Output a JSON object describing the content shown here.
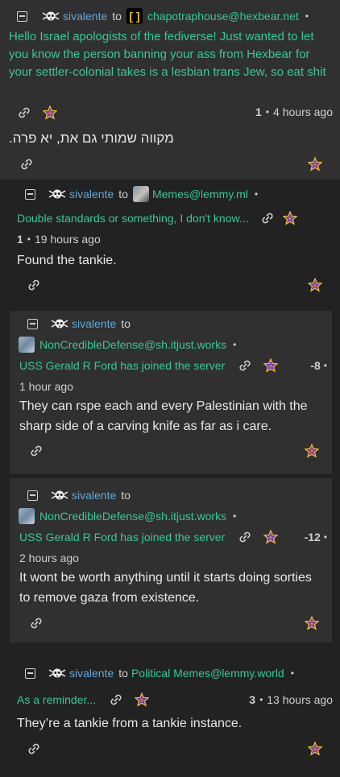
{
  "comments": [
    {
      "user": "sivalente",
      "to": "to",
      "community": "chapotraphouse@hexbear.net",
      "post_text": "Hello Israel apologists of the fediverse! Just wanted to let you know the person banning your ass from Hexbear for your settler-colonial takes is a lesbian trans Jew, so eat shit",
      "score": "1",
      "time": "4 hours ago",
      "body": "מקווה שמותי גם את, יא פרה."
    },
    {
      "user": "sivalente",
      "to": "to",
      "community": "Memes@lemmy.ml",
      "post_title": "Double standards or something, I don't know...",
      "score": "1",
      "time": "19 hours ago",
      "body": "Found the tankie."
    },
    {
      "user": "sivalente",
      "to": "to",
      "community": "NonCredibleDefense@sh.itjust.works",
      "post_title": "USS Gerald R Ford has joined the server",
      "score": "-8",
      "time": "1 hour ago",
      "body_lines": [
        "They can rspe each and every Palestinian with the",
        "sharp side of a carving knife as far as i care."
      ]
    },
    {
      "user": "sivalente",
      "to": "to",
      "community": "NonCredibleDefense@sh.itjust.works",
      "post_title": "USS Gerald R Ford has joined the server",
      "score": "-12",
      "time": "2 hours ago",
      "body_lines": [
        "It wont be worth anything until it starts doing sorties",
        "to remove gaza from existence."
      ]
    },
    {
      "user": "sivalente",
      "to": "to",
      "community": "Political Memes@lemmy.world",
      "post_title": "As a reminder...",
      "score": "3",
      "time": "13 hours ago",
      "body": "They’re a tankie from a tankie instance."
    }
  ],
  "separators": {
    "dot": "•"
  },
  "colors": {
    "user": "#5fa8d8",
    "community": "#34c89a",
    "card": "#303030",
    "background": "#222222"
  },
  "icons": {
    "collapse": "collapse-icon",
    "skull": "skull-icon",
    "link": "link-icon",
    "star": "rainbow-star-icon"
  }
}
